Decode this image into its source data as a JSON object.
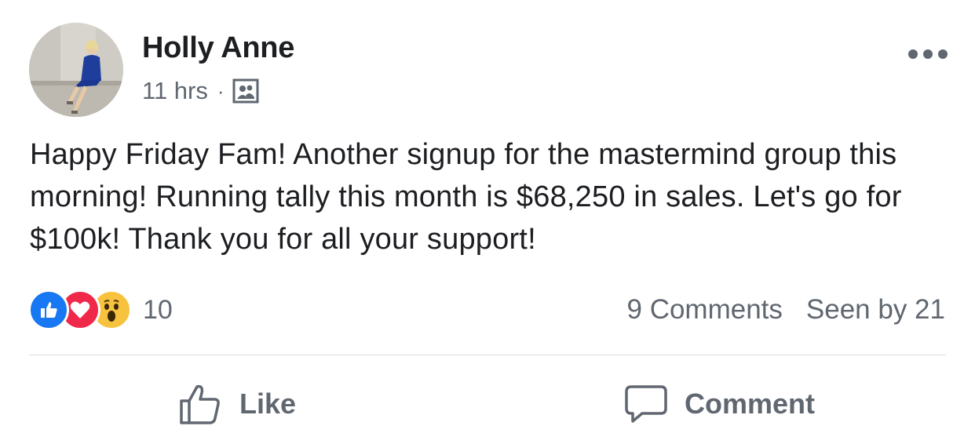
{
  "post": {
    "author": "Holly Anne",
    "time": "11 hrs",
    "separator": "·",
    "audience_icon": "group-audience-icon",
    "text": "Happy Friday Fam! Another signup for the mastermind group this morning! Running tally this month is $68,250 in sales. Let's go for $100k! Thank you for all your support!"
  },
  "reactions": {
    "icons": [
      "like-reaction-icon",
      "love-reaction-icon",
      "wow-reaction-icon"
    ],
    "count": "10"
  },
  "stats": {
    "comments": "9 Comments",
    "seen": "Seen by 21"
  },
  "actions": {
    "like_label": "Like",
    "comment_label": "Comment"
  },
  "colors": {
    "text_primary": "#1c1e21",
    "text_secondary": "#606770",
    "like_blue": "#1877f2",
    "love_red": "#f0284a",
    "wow_yellow": "#f7c33e",
    "divider": "#dadde1"
  }
}
